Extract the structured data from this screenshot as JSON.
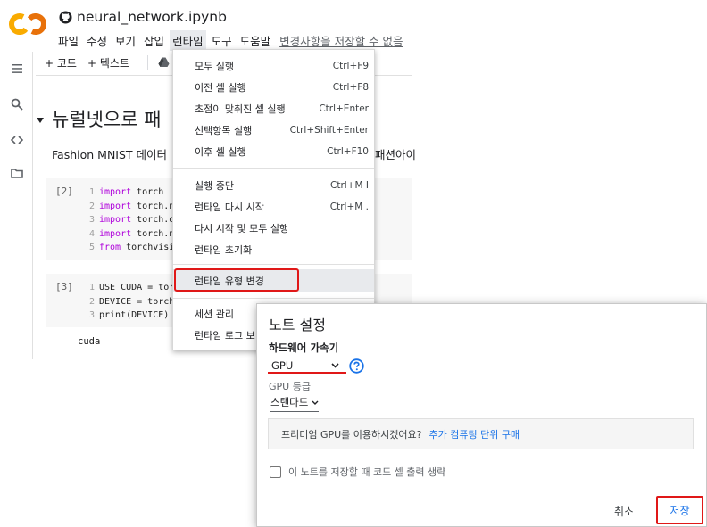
{
  "window": {
    "file_name": "neural_network.ipynb"
  },
  "menubar": {
    "items": [
      "파일",
      "수정",
      "보기",
      "삽입",
      "런타임",
      "도구",
      "도움말"
    ],
    "unsaved_notice": "변경사항을 저장할 수 없음",
    "active_item": "런타임"
  },
  "toolbar": {
    "add_code": "+ 코드",
    "add_text": "+ 텍스트"
  },
  "notebook": {
    "section_heading": "뉴럴넷으로 패",
    "intro_text": "Fashion MNIST 데이터",
    "intro_tail": "패션아이",
    "cell1": {
      "exec_label": "[2]",
      "lines": [
        {
          "num": "1",
          "kw": "import",
          "rest": " torch"
        },
        {
          "num": "2",
          "kw": "import",
          "rest": " torch.nn"
        },
        {
          "num": "3",
          "kw": "import",
          "rest": " torch.op"
        },
        {
          "num": "4",
          "kw": "import",
          "rest": " torch.nn"
        },
        {
          "num": "5",
          "kw": "from",
          "rest": " torchvisio"
        }
      ]
    },
    "cell2": {
      "exec_label": "[3]",
      "lines": [
        {
          "num": "1",
          "kw": "",
          "rest": "USE_CUDA = torc"
        },
        {
          "num": "2",
          "kw": "",
          "rest": "DEVICE = torch"
        },
        {
          "num": "3",
          "kw": "",
          "rest": "print(DEVICE)"
        }
      ]
    },
    "output": "cuda"
  },
  "runtime_menu": {
    "items": [
      {
        "label": "모두 실행",
        "shortcut": "Ctrl+F9"
      },
      {
        "label": "이전 셀 실행",
        "shortcut": "Ctrl+F8"
      },
      {
        "label": "초점이 맞춰진 셀 실행",
        "shortcut": "Ctrl+Enter"
      },
      {
        "label": "선택항목 실행",
        "shortcut": "Ctrl+Shift+Enter"
      },
      {
        "label": "이후 셀 실행",
        "shortcut": "Ctrl+F10"
      },
      {
        "label": "실행 중단",
        "shortcut": "Ctrl+M I"
      },
      {
        "label": "런타임 다시 시작",
        "shortcut": "Ctrl+M ."
      },
      {
        "label": "다시 시작 및 모두 실행",
        "shortcut": ""
      },
      {
        "label": "런타임 초기화",
        "shortcut": ""
      },
      {
        "label": "런타임 유형 변경",
        "shortcut": ""
      },
      {
        "label": "세션 관리",
        "shortcut": ""
      },
      {
        "label": "런타임 로그 보",
        "shortcut": ""
      }
    ],
    "highlighted_item": "런타임 유형 변경"
  },
  "dialog": {
    "title": "노트 설정",
    "hw_label": "하드웨어 가속기",
    "hw_value": "GPU",
    "tier_label": "GPU 등급",
    "tier_value": "스탠다드",
    "premium_text": "프리미엄 GPU를 이용하시겠어요?",
    "premium_link": "추가 컴퓨팅 단위 구매",
    "omit_output_label": "이 노트를 저장할 때 코드 셀 출력 생략",
    "omit_output_checked": false,
    "cancel_label": "취소",
    "save_label": "저장"
  },
  "colors": {
    "logo_orange": "#f9ab00",
    "logo_dark_orange": "#e8710a",
    "link_blue": "#1a73e8",
    "annotation_red": "#e01818",
    "keyword_purple": "#af00db"
  }
}
